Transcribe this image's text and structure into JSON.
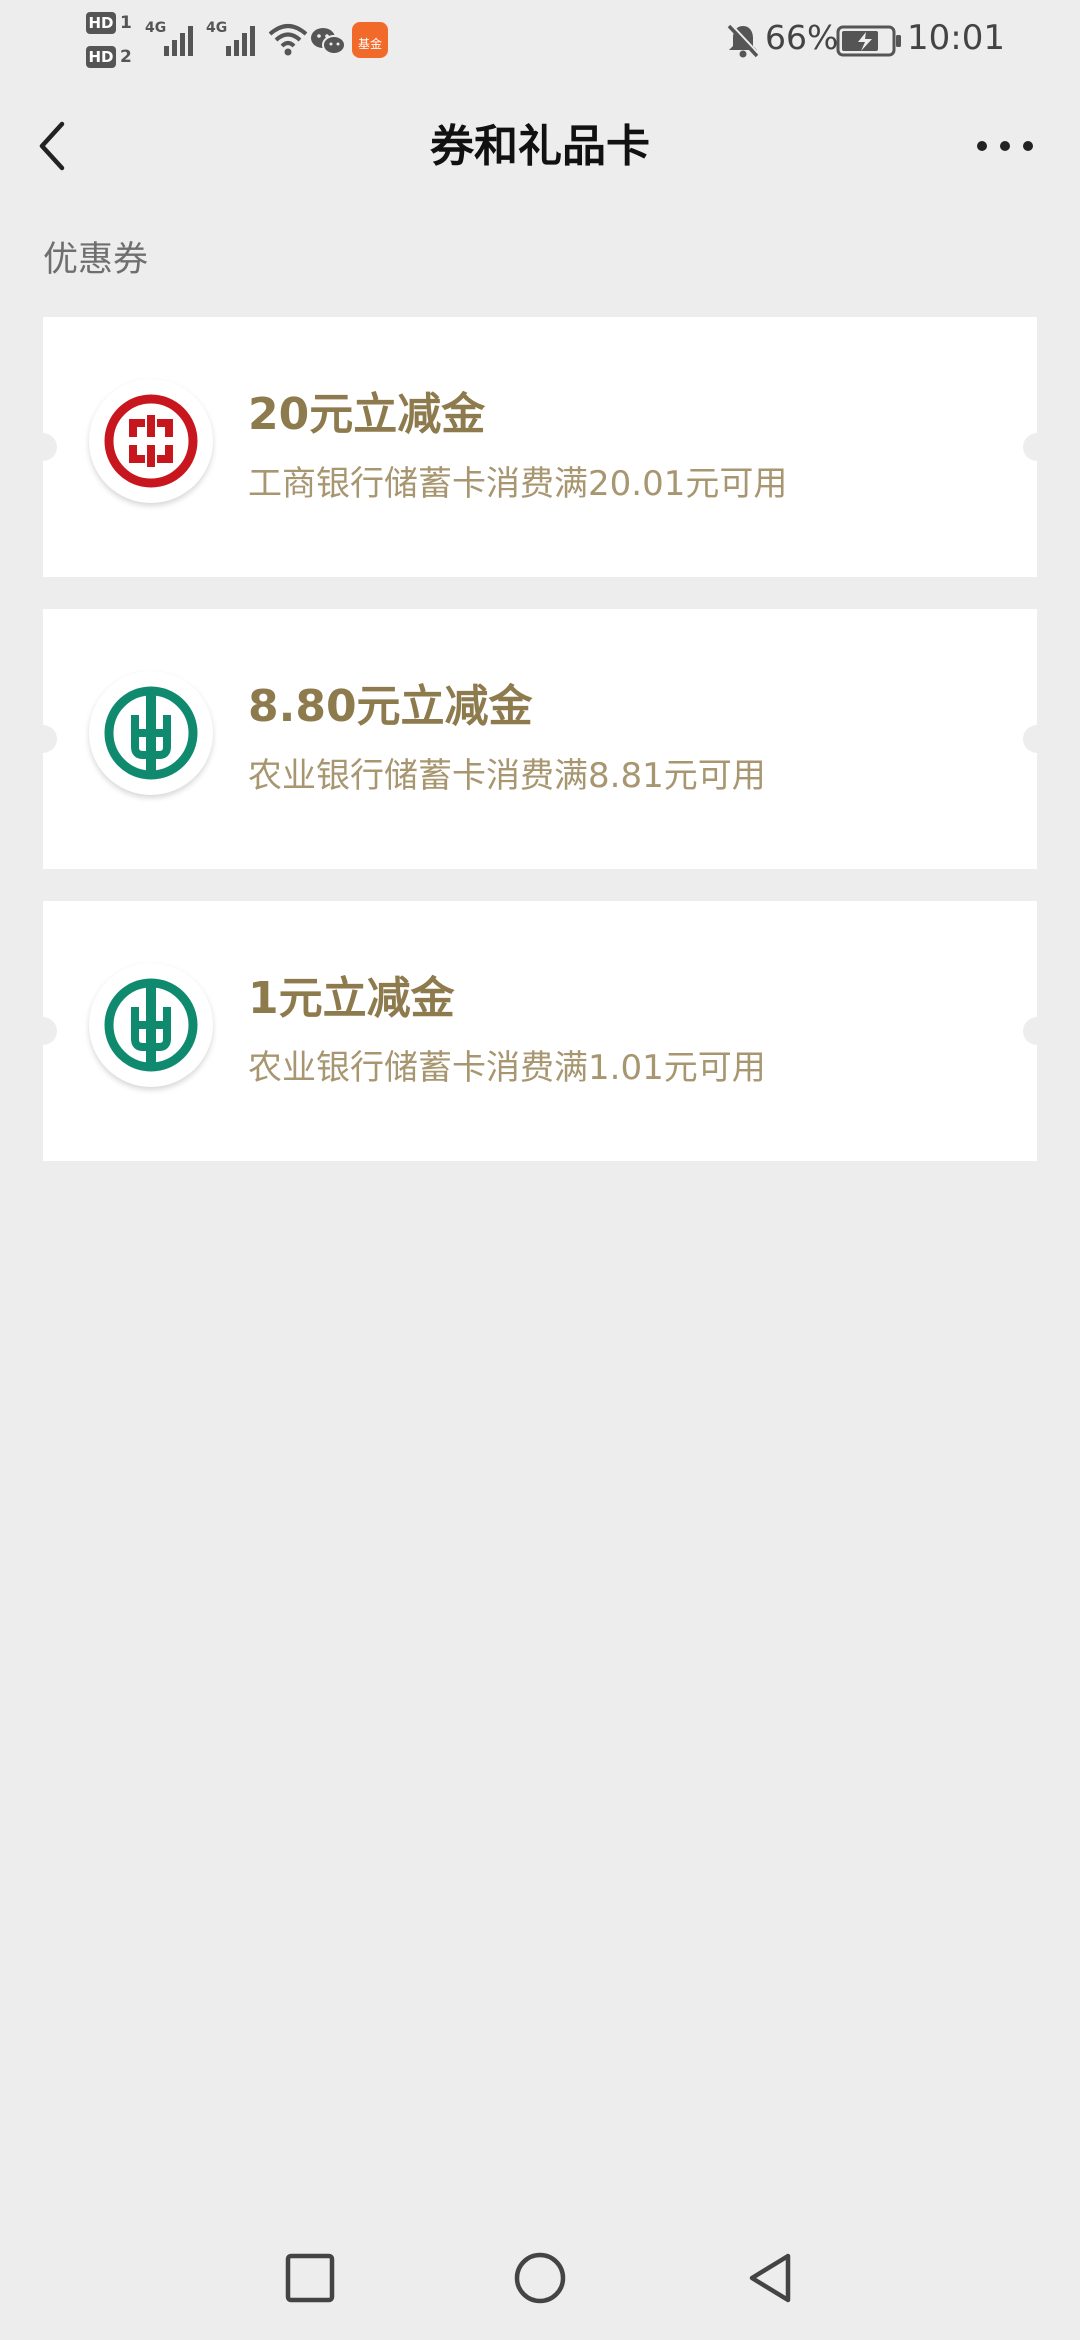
{
  "status_bar": {
    "sim1_badge": "HD",
    "sim1_number": "1",
    "sim2_badge": "HD",
    "sim2_number": "2",
    "network1": "4G",
    "network2": "4G",
    "app_icon_text": "基金",
    "battery_percent": "66%",
    "time": "10:01"
  },
  "nav": {
    "title": "券和礼品卡"
  },
  "section": {
    "label": "优惠券"
  },
  "coupons": [
    {
      "title": "20元立减金",
      "desc": "工商银行储蓄卡消费满20.01元可用",
      "bank_icon": "icbc-logo-icon"
    },
    {
      "title": "8.80元立减金",
      "desc": "农业银行储蓄卡消费满8.81元可用",
      "bank_icon": "abc-logo-icon"
    },
    {
      "title": "1元立减金",
      "desc": "农业银行储蓄卡消费满1.01元可用",
      "bank_icon": "abc-logo-icon"
    }
  ],
  "colors": {
    "background": "#ededed",
    "card": "#ffffff",
    "coupon_title": "#8d7a4d",
    "coupon_desc": "#a79670",
    "icbc_red": "#c7161e",
    "abc_green": "#0f8a6f"
  }
}
